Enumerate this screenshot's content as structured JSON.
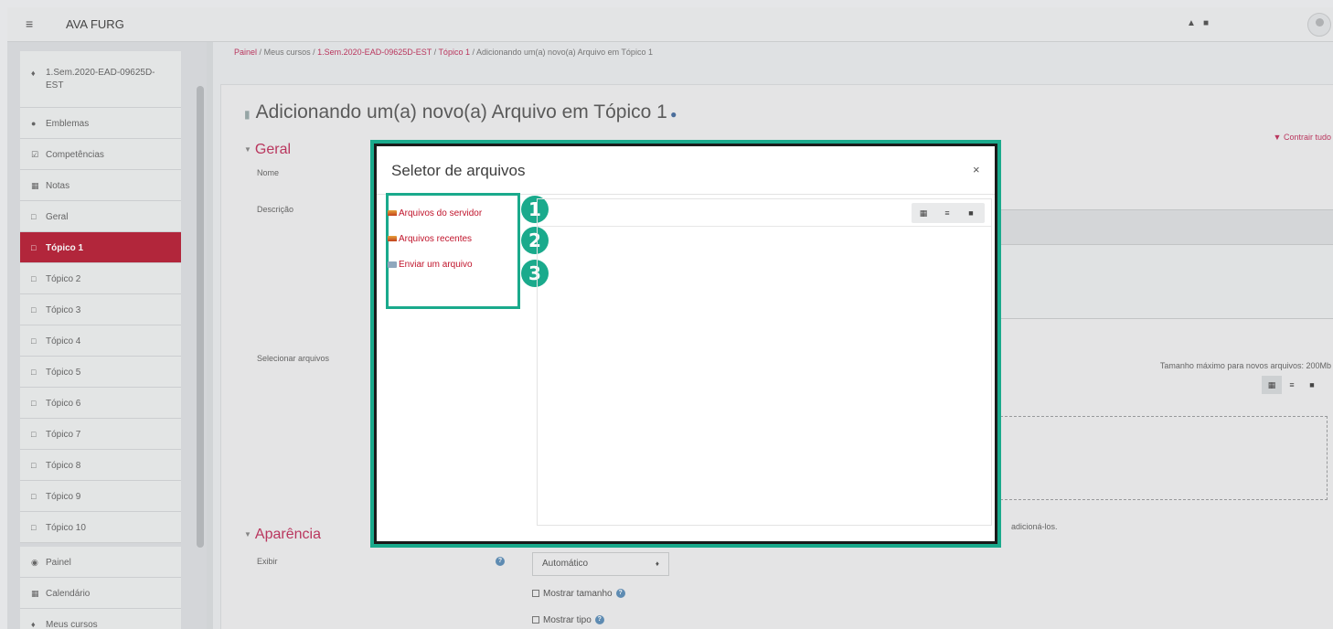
{
  "navbar": {
    "site_name": "AVA FURG",
    "menu_icon": "hamburger-icon",
    "icons": [
      "bell-icon",
      "chat-icon"
    ]
  },
  "sidebar": {
    "course": "1.Sem.2020-EAD-09625D-EST",
    "items": [
      {
        "label": "Emblemas",
        "icon": "shield-icon"
      },
      {
        "label": "Competências",
        "icon": "checkbox-icon"
      },
      {
        "label": "Notas",
        "icon": "table-icon"
      },
      {
        "label": "Geral",
        "icon": "folder-icon"
      },
      {
        "label": "Tópico 1",
        "icon": "folder-icon",
        "active": true
      },
      {
        "label": "Tópico 2",
        "icon": "folder-icon"
      },
      {
        "label": "Tópico 3",
        "icon": "folder-icon"
      },
      {
        "label": "Tópico 4",
        "icon": "folder-icon"
      },
      {
        "label": "Tópico 5",
        "icon": "folder-icon"
      },
      {
        "label": "Tópico 6",
        "icon": "folder-icon"
      },
      {
        "label": "Tópico 7",
        "icon": "folder-icon"
      },
      {
        "label": "Tópico 8",
        "icon": "folder-icon"
      },
      {
        "label": "Tópico 9",
        "icon": "folder-icon"
      },
      {
        "label": "Tópico 10",
        "icon": "folder-icon"
      },
      {
        "label": "Painel",
        "icon": "dashboard-icon"
      },
      {
        "label": "Calendário",
        "icon": "calendar-icon"
      },
      {
        "label": "Meus cursos",
        "icon": "graduation-cap-icon"
      }
    ]
  },
  "breadcrumb": {
    "home": "Painel",
    "my_courses": "Meus cursos",
    "course": "1.Sem.2020-EAD-09625D-EST",
    "topic": "Tópico 1",
    "current": "Adicionando um(a) novo(a) Arquivo em Tópico 1",
    "separator": "/"
  },
  "page": {
    "title": "Adicionando um(a) novo(a) Arquivo em Tópico 1",
    "collapse_all": "Contrair tudo",
    "section_general": "Geral",
    "label_name": "Nome",
    "label_description": "Descrição",
    "label_select_files": "Selecionar arquivos",
    "max_size": "Tamanho máximo para novos arquivos: 200Mb",
    "drop_text": "adicioná-los.",
    "section_appearance": "Aparência",
    "label_display": "Exibir",
    "display_value": "Automático",
    "show_size": "Mostrar tamanho",
    "show_type": "Mostrar tipo"
  },
  "modal": {
    "title": "Seletor de arquivos",
    "close": "×",
    "repositories": [
      {
        "label": "Arquivos do servidor",
        "badge": "1"
      },
      {
        "label": "Arquivos recentes",
        "badge": "2"
      },
      {
        "label": "Enviar um arquivo",
        "badge": "3"
      }
    ]
  },
  "colors": {
    "accent_red": "#c0355f",
    "active_nav": "#b8243a",
    "annotation_teal": "#1aaa8c"
  }
}
